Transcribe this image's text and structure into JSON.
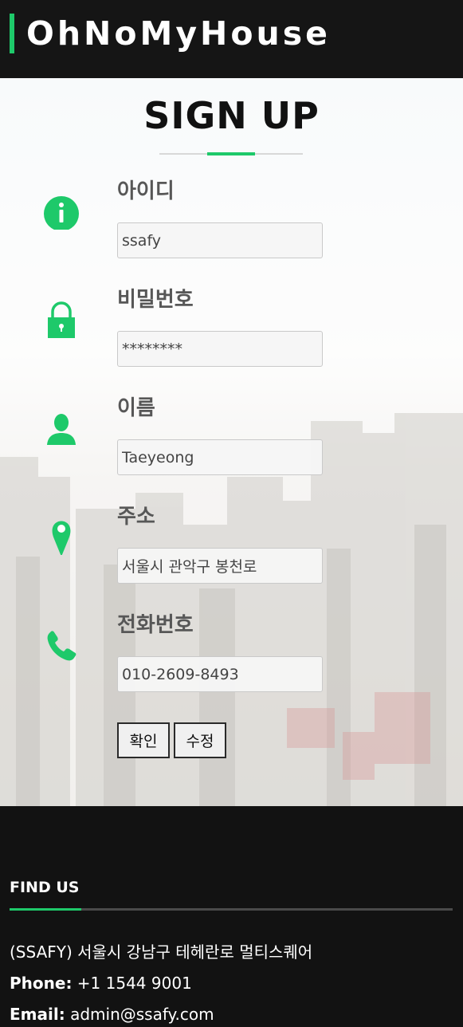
{
  "app": {
    "brand": "OhNoMyHouse",
    "accent_color": "#1ec96a"
  },
  "signup": {
    "title": "SIGN UP",
    "fields": [
      {
        "label": "아이디",
        "value": "ssafy",
        "icon": "info-icon"
      },
      {
        "label": "비밀번호",
        "value": "********",
        "icon": "lock-icon"
      },
      {
        "label": "이름",
        "value": "Taeyeong",
        "icon": "user-icon"
      },
      {
        "label": "주소",
        "value": "서울시 관악구 봉천로",
        "icon": "location-pin-icon"
      },
      {
        "label": "전화번호",
        "value": "010-2609-8493",
        "icon": "phone-icon"
      }
    ],
    "confirm_label": "확인",
    "edit_label": "수정"
  },
  "footer": {
    "title": "FIND US",
    "address": "(SSAFY) 서울시 강남구 테헤란로 멀티스퀘어",
    "phone_label": "Phone:",
    "phone": "+1 1544 9001",
    "email_label": "Email:",
    "email": "admin@ssafy.com"
  }
}
